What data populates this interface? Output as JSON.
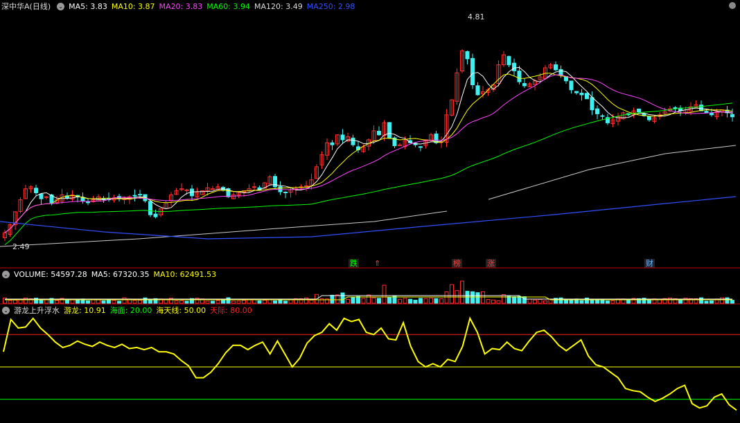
{
  "price_panel": {
    "title": "深中华A(日线)",
    "ma_labels": [
      {
        "key": "MA5",
        "value": "3.83",
        "color": "#ffffff"
      },
      {
        "key": "MA10",
        "value": "3.87",
        "color": "#ffff00"
      },
      {
        "key": "MA20",
        "value": "3.83",
        "color": "#ff44ff"
      },
      {
        "key": "MA60",
        "value": "3.94",
        "color": "#00ff00"
      },
      {
        "key": "MA120",
        "value": "3.49",
        "color": "#dddddd"
      },
      {
        "key": "MA250",
        "value": "2.98",
        "color": "#3050ff"
      }
    ],
    "high_marker": "4.81",
    "low_marker": "2.49"
  },
  "event_markers": [
    {
      "label": "跌",
      "color": "#00ff00"
    },
    {
      "label": "⇑",
      "color": "#ff4040"
    },
    {
      "label": "榜",
      "color": "#ff4040"
    },
    {
      "label": "涨",
      "color": "#ff4040"
    },
    {
      "label": "财",
      "color": "#66bbff"
    }
  ],
  "volume_panel": {
    "labels": [
      {
        "key": "VOLUME",
        "value": "54597.28",
        "color": "#ffffff"
      },
      {
        "key": "MA5",
        "value": "67320.35",
        "color": "#ffffff"
      },
      {
        "key": "MA10",
        "value": "62491.53",
        "color": "#ffff00"
      }
    ]
  },
  "indicator_panel": {
    "name": "游龙上升浮水",
    "labels": [
      {
        "key": "游龙",
        "value": "10.91",
        "color": "#ffff00"
      },
      {
        "key": "海面",
        "value": "20.00",
        "color": "#00ff00"
      },
      {
        "key": "海天线",
        "value": "50.00",
        "color": "#ffff00"
      },
      {
        "key": "天际",
        "value": "80.00",
        "color": "#ff2020"
      }
    ]
  },
  "colors": {
    "up": "#ff3030",
    "down": "#40f0f0",
    "ma5": "#ffffff",
    "ma10": "#ffff00",
    "ma20": "#ff44ff",
    "ma60": "#00ff00",
    "ma120": "#cccccc",
    "ma250": "#3050ff"
  },
  "chart_data": [
    {
      "type": "candlestick",
      "title": "深中华A(日线)",
      "y_range": [
        2.49,
        4.81
      ],
      "n_bars": 141,
      "closes": [
        2.62,
        2.7,
        2.83,
        2.95,
        3.06,
        3.08,
        3.02,
        2.96,
        2.98,
        2.92,
        2.95,
        3.0,
        2.97,
        3.0,
        2.98,
        2.94,
        2.92,
        2.95,
        2.98,
        2.96,
        2.95,
        2.97,
        2.96,
        2.97,
        2.98,
        2.99,
        3.0,
        2.94,
        2.8,
        2.78,
        2.86,
        2.92,
        3.0,
        3.04,
        3.06,
        3.05,
        2.99,
        3.02,
        3.04,
        3.07,
        3.06,
        3.08,
        3.05,
        2.98,
        3.0,
        3.03,
        3.04,
        3.06,
        3.08,
        3.05,
        3.12,
        3.18,
        3.08,
        3.03,
        3.02,
        3.05,
        3.06,
        3.08,
        3.09,
        3.15,
        3.28,
        3.4,
        3.52,
        3.5,
        3.6,
        3.55,
        3.58,
        3.5,
        3.45,
        3.48,
        3.55,
        3.64,
        3.6,
        3.72,
        3.57,
        3.49,
        3.5,
        3.54,
        3.52,
        3.5,
        3.48,
        3.55,
        3.6,
        3.52,
        3.53,
        3.8,
        3.95,
        4.22,
        4.44,
        4.36,
        4.1,
        4.0,
        4.03,
        4.05,
        4.1,
        4.3,
        4.4,
        4.3,
        4.24,
        4.13,
        4.09,
        4.11,
        4.14,
        4.18,
        4.27,
        4.3,
        4.25,
        4.2,
        4.14,
        4.05,
        4.02,
        4.0,
        3.96,
        3.85,
        3.81,
        3.79,
        3.72,
        3.75,
        3.78,
        3.82,
        3.8,
        3.84,
        3.83,
        3.79,
        3.75,
        3.77,
        3.8,
        3.83,
        3.86,
        3.87,
        3.84,
        3.85,
        3.88,
        3.9,
        3.84,
        3.82,
        3.8,
        3.83,
        3.85,
        3.82,
        3.78
      ],
      "ma_current": {
        "MA5": 3.83,
        "MA10": 3.87,
        "MA20": 3.83,
        "MA60": 3.94,
        "MA120": 3.49,
        "MA250": 2.98
      },
      "annotations": [
        "4.81",
        "2.49"
      ]
    },
    {
      "type": "bar",
      "title": "VOLUME",
      "values_current": {
        "VOLUME": 54597.28,
        "MA5": 67320.35,
        "MA10": 62491.53
      }
    },
    {
      "type": "line",
      "title": "游龙上升浮水",
      "ylim": [
        0,
        100
      ],
      "reference_lines": [
        {
          "name": "海面",
          "value": 20
        },
        {
          "name": "海天线",
          "value": 50
        },
        {
          "name": "天际",
          "value": 80
        }
      ],
      "series": [
        {
          "name": "游龙",
          "values": [
            64,
            94,
            86,
            87,
            95,
            86,
            80,
            73,
            68,
            70,
            74,
            71,
            69,
            73,
            70,
            68,
            71,
            67,
            68,
            66,
            68,
            64,
            64,
            62,
            56,
            51,
            40,
            40,
            45,
            53,
            63,
            70,
            70,
            66,
            70,
            73,
            62,
            74,
            62,
            50,
            58,
            72,
            79,
            82,
            90,
            84,
            95,
            92,
            94,
            82,
            80,
            86,
            76,
            75,
            91,
            69,
            55,
            50,
            53,
            50,
            57,
            55,
            69,
            95,
            82,
            62,
            67,
            66,
            73,
            67,
            65,
            74,
            82,
            84,
            78,
            70,
            65,
            70,
            75,
            60,
            52,
            50,
            45,
            40,
            30,
            28,
            27,
            22,
            18,
            21,
            25,
            30,
            33,
            16,
            12,
            14,
            22,
            25,
            15,
            10
          ]
        }
      ],
      "current": {
        "游龙": 10.91
      }
    }
  ]
}
